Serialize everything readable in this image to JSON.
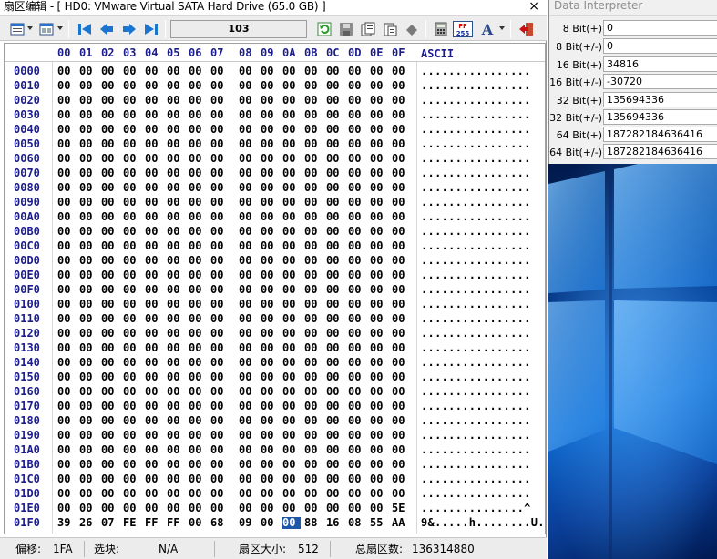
{
  "window": {
    "title": "扇区编辑 - [ HD0: VMware Virtual SATA Hard Drive (65.0 GB) ]",
    "close_glyph": "×"
  },
  "toolbar": {
    "sector_number": "103",
    "icons": [
      "view-options-icon",
      "columns-icon",
      "first-sector-icon",
      "previous-sector-icon",
      "next-sector-icon",
      "last-sector-icon",
      "refresh-icon",
      "save-icon",
      "copy-icon",
      "paste-icon",
      "erase-icon",
      "calculator-icon",
      "hex-dec-icon",
      "font-icon",
      "exit-icon"
    ]
  },
  "hex": {
    "column_headers": [
      "00",
      "01",
      "02",
      "03",
      "04",
      "05",
      "06",
      "07",
      "08",
      "09",
      "0A",
      "0B",
      "0C",
      "0D",
      "0E",
      "0F"
    ],
    "ascii_header": "ASCII",
    "rows": [
      {
        "offset": "0000",
        "bytes": [
          "00",
          "00",
          "00",
          "00",
          "00",
          "00",
          "00",
          "00",
          "00",
          "00",
          "00",
          "00",
          "00",
          "00",
          "00",
          "00"
        ],
        "ascii": "................"
      },
      {
        "offset": "0010",
        "bytes": [
          "00",
          "00",
          "00",
          "00",
          "00",
          "00",
          "00",
          "00",
          "00",
          "00",
          "00",
          "00",
          "00",
          "00",
          "00",
          "00"
        ],
        "ascii": "................"
      },
      {
        "offset": "0020",
        "bytes": [
          "00",
          "00",
          "00",
          "00",
          "00",
          "00",
          "00",
          "00",
          "00",
          "00",
          "00",
          "00",
          "00",
          "00",
          "00",
          "00"
        ],
        "ascii": "................"
      },
      {
        "offset": "0030",
        "bytes": [
          "00",
          "00",
          "00",
          "00",
          "00",
          "00",
          "00",
          "00",
          "00",
          "00",
          "00",
          "00",
          "00",
          "00",
          "00",
          "00"
        ],
        "ascii": "................"
      },
      {
        "offset": "0040",
        "bytes": [
          "00",
          "00",
          "00",
          "00",
          "00",
          "00",
          "00",
          "00",
          "00",
          "00",
          "00",
          "00",
          "00",
          "00",
          "00",
          "00"
        ],
        "ascii": "................"
      },
      {
        "offset": "0050",
        "bytes": [
          "00",
          "00",
          "00",
          "00",
          "00",
          "00",
          "00",
          "00",
          "00",
          "00",
          "00",
          "00",
          "00",
          "00",
          "00",
          "00"
        ],
        "ascii": "................"
      },
      {
        "offset": "0060",
        "bytes": [
          "00",
          "00",
          "00",
          "00",
          "00",
          "00",
          "00",
          "00",
          "00",
          "00",
          "00",
          "00",
          "00",
          "00",
          "00",
          "00"
        ],
        "ascii": "................"
      },
      {
        "offset": "0070",
        "bytes": [
          "00",
          "00",
          "00",
          "00",
          "00",
          "00",
          "00",
          "00",
          "00",
          "00",
          "00",
          "00",
          "00",
          "00",
          "00",
          "00"
        ],
        "ascii": "................"
      },
      {
        "offset": "0080",
        "bytes": [
          "00",
          "00",
          "00",
          "00",
          "00",
          "00",
          "00",
          "00",
          "00",
          "00",
          "00",
          "00",
          "00",
          "00",
          "00",
          "00"
        ],
        "ascii": "................"
      },
      {
        "offset": "0090",
        "bytes": [
          "00",
          "00",
          "00",
          "00",
          "00",
          "00",
          "00",
          "00",
          "00",
          "00",
          "00",
          "00",
          "00",
          "00",
          "00",
          "00"
        ],
        "ascii": "................"
      },
      {
        "offset": "00A0",
        "bytes": [
          "00",
          "00",
          "00",
          "00",
          "00",
          "00",
          "00",
          "00",
          "00",
          "00",
          "00",
          "00",
          "00",
          "00",
          "00",
          "00"
        ],
        "ascii": "................"
      },
      {
        "offset": "00B0",
        "bytes": [
          "00",
          "00",
          "00",
          "00",
          "00",
          "00",
          "00",
          "00",
          "00",
          "00",
          "00",
          "00",
          "00",
          "00",
          "00",
          "00"
        ],
        "ascii": "................"
      },
      {
        "offset": "00C0",
        "bytes": [
          "00",
          "00",
          "00",
          "00",
          "00",
          "00",
          "00",
          "00",
          "00",
          "00",
          "00",
          "00",
          "00",
          "00",
          "00",
          "00"
        ],
        "ascii": "................"
      },
      {
        "offset": "00D0",
        "bytes": [
          "00",
          "00",
          "00",
          "00",
          "00",
          "00",
          "00",
          "00",
          "00",
          "00",
          "00",
          "00",
          "00",
          "00",
          "00",
          "00"
        ],
        "ascii": "................"
      },
      {
        "offset": "00E0",
        "bytes": [
          "00",
          "00",
          "00",
          "00",
          "00",
          "00",
          "00",
          "00",
          "00",
          "00",
          "00",
          "00",
          "00",
          "00",
          "00",
          "00"
        ],
        "ascii": "................"
      },
      {
        "offset": "00F0",
        "bytes": [
          "00",
          "00",
          "00",
          "00",
          "00",
          "00",
          "00",
          "00",
          "00",
          "00",
          "00",
          "00",
          "00",
          "00",
          "00",
          "00"
        ],
        "ascii": "................"
      },
      {
        "offset": "0100",
        "bytes": [
          "00",
          "00",
          "00",
          "00",
          "00",
          "00",
          "00",
          "00",
          "00",
          "00",
          "00",
          "00",
          "00",
          "00",
          "00",
          "00"
        ],
        "ascii": "................"
      },
      {
        "offset": "0110",
        "bytes": [
          "00",
          "00",
          "00",
          "00",
          "00",
          "00",
          "00",
          "00",
          "00",
          "00",
          "00",
          "00",
          "00",
          "00",
          "00",
          "00"
        ],
        "ascii": "................"
      },
      {
        "offset": "0120",
        "bytes": [
          "00",
          "00",
          "00",
          "00",
          "00",
          "00",
          "00",
          "00",
          "00",
          "00",
          "00",
          "00",
          "00",
          "00",
          "00",
          "00"
        ],
        "ascii": "................"
      },
      {
        "offset": "0130",
        "bytes": [
          "00",
          "00",
          "00",
          "00",
          "00",
          "00",
          "00",
          "00",
          "00",
          "00",
          "00",
          "00",
          "00",
          "00",
          "00",
          "00"
        ],
        "ascii": "................"
      },
      {
        "offset": "0140",
        "bytes": [
          "00",
          "00",
          "00",
          "00",
          "00",
          "00",
          "00",
          "00",
          "00",
          "00",
          "00",
          "00",
          "00",
          "00",
          "00",
          "00"
        ],
        "ascii": "................"
      },
      {
        "offset": "0150",
        "bytes": [
          "00",
          "00",
          "00",
          "00",
          "00",
          "00",
          "00",
          "00",
          "00",
          "00",
          "00",
          "00",
          "00",
          "00",
          "00",
          "00"
        ],
        "ascii": "................"
      },
      {
        "offset": "0160",
        "bytes": [
          "00",
          "00",
          "00",
          "00",
          "00",
          "00",
          "00",
          "00",
          "00",
          "00",
          "00",
          "00",
          "00",
          "00",
          "00",
          "00"
        ],
        "ascii": "................"
      },
      {
        "offset": "0170",
        "bytes": [
          "00",
          "00",
          "00",
          "00",
          "00",
          "00",
          "00",
          "00",
          "00",
          "00",
          "00",
          "00",
          "00",
          "00",
          "00",
          "00"
        ],
        "ascii": "................"
      },
      {
        "offset": "0180",
        "bytes": [
          "00",
          "00",
          "00",
          "00",
          "00",
          "00",
          "00",
          "00",
          "00",
          "00",
          "00",
          "00",
          "00",
          "00",
          "00",
          "00"
        ],
        "ascii": "................"
      },
      {
        "offset": "0190",
        "bytes": [
          "00",
          "00",
          "00",
          "00",
          "00",
          "00",
          "00",
          "00",
          "00",
          "00",
          "00",
          "00",
          "00",
          "00",
          "00",
          "00"
        ],
        "ascii": "................"
      },
      {
        "offset": "01A0",
        "bytes": [
          "00",
          "00",
          "00",
          "00",
          "00",
          "00",
          "00",
          "00",
          "00",
          "00",
          "00",
          "00",
          "00",
          "00",
          "00",
          "00"
        ],
        "ascii": "................"
      },
      {
        "offset": "01B0",
        "bytes": [
          "00",
          "00",
          "00",
          "00",
          "00",
          "00",
          "00",
          "00",
          "00",
          "00",
          "00",
          "00",
          "00",
          "00",
          "00",
          "00"
        ],
        "ascii": "................"
      },
      {
        "offset": "01C0",
        "bytes": [
          "00",
          "00",
          "00",
          "00",
          "00",
          "00",
          "00",
          "00",
          "00",
          "00",
          "00",
          "00",
          "00",
          "00",
          "00",
          "00"
        ],
        "ascii": "................"
      },
      {
        "offset": "01D0",
        "bytes": [
          "00",
          "00",
          "00",
          "00",
          "00",
          "00",
          "00",
          "00",
          "00",
          "00",
          "00",
          "00",
          "00",
          "00",
          "00",
          "00"
        ],
        "ascii": "................"
      },
      {
        "offset": "01E0",
        "bytes": [
          "00",
          "00",
          "00",
          "00",
          "00",
          "00",
          "00",
          "00",
          "00",
          "00",
          "00",
          "00",
          "00",
          "00",
          "00",
          "5E"
        ],
        "ascii": "...............^"
      },
      {
        "offset": "01F0",
        "bytes": [
          "39",
          "26",
          "07",
          "FE",
          "FF",
          "FF",
          "00",
          "68",
          "09",
          "00",
          "00",
          "88",
          "16",
          "08",
          "55",
          "AA"
        ],
        "ascii": "9&.....h........U."
      }
    ],
    "selected": {
      "row": 31,
      "col": 10
    }
  },
  "statusbar": {
    "offset_label": "偏移:",
    "offset_value": "1FA",
    "block_label": "选块:",
    "block_value": "N/A",
    "sector_size_label": "扇区大小:",
    "sector_size_value": "512",
    "total_sectors_label": "总扇区数:",
    "total_sectors_value": "136314880"
  },
  "interpreter": {
    "title": "Data Interpreter",
    "rows": [
      {
        "label": "8 Bit(+)",
        "value": "0"
      },
      {
        "label": "8 Bit(+/-)",
        "value": "0"
      },
      {
        "label": "16 Bit(+)",
        "value": "34816"
      },
      {
        "label": "16 Bit(+/-)",
        "value": "-30720"
      },
      {
        "label": "32 Bit(+)",
        "value": "135694336"
      },
      {
        "label": "32 Bit(+/-)",
        "value": "135694336"
      },
      {
        "label": "64 Bit(+)",
        "value": "187282184636416"
      },
      {
        "label": "64 Bit(+/-)",
        "value": "187282184636416"
      }
    ]
  },
  "colors": {
    "offset_blue": "#1c1c8c",
    "selection": "#1f57a8",
    "desktop_blue": "#0a63c9"
  }
}
